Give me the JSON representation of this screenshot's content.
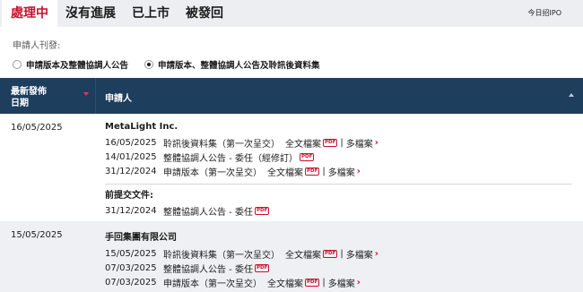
{
  "tabs": [
    {
      "label": "處理中",
      "active": true
    },
    {
      "label": "沒有進展",
      "active": false
    },
    {
      "label": "已上市",
      "active": false
    },
    {
      "label": "被發回",
      "active": false
    }
  ],
  "ipo_link": "今日招IPO",
  "filter": {
    "label": "申請人刊發:",
    "options": [
      {
        "label": "申請版本及整體協調人公告",
        "selected": false
      },
      {
        "label": "申請版本、整體協調人公告及聆訊後資料集",
        "selected": true
      }
    ]
  },
  "table": {
    "col_date": [
      "最新發佈",
      "日期"
    ],
    "col_applicant": "申請人",
    "rows": [
      {
        "date": "16/05/2025",
        "company": "MetaLight Inc.",
        "docs": [
          {
            "date": "16/05/2025",
            "title": "聆訊後資料集（第一次呈交）",
            "full": "全文檔案",
            "pdf": "PDF",
            "more": "多檔案"
          },
          {
            "date": "14/01/2025",
            "title": "整體協調人公告 - 委任（經修訂）",
            "full": "",
            "pdf": "PDF",
            "more": ""
          },
          {
            "date": "31/12/2024",
            "title": "申請版本（第一次呈交）",
            "full": "全文檔案",
            "pdf": "PDF",
            "more": "多檔案"
          }
        ],
        "prior_label": "前提交文件:",
        "prior_docs": [
          {
            "date": "31/12/2024",
            "title": "整體協調人公告 - 委任",
            "pdf": "PDF"
          }
        ]
      },
      {
        "date": "15/05/2025",
        "company": "手回集團有限公司",
        "docs": [
          {
            "date": "15/05/2025",
            "title": "聆訊後資料集（第一次呈交）",
            "full": "全文檔案",
            "pdf": "PDF",
            "more": "多檔案"
          },
          {
            "date": "07/03/2025",
            "title": "整體協調人公告 - 委任",
            "full": "",
            "pdf": "PDF",
            "more": ""
          },
          {
            "date": "07/03/2025",
            "title": "申請版本（第一次呈交）",
            "full": "全文檔案",
            "pdf": "PDF",
            "more": "多檔案"
          }
        ]
      }
    ]
  },
  "colors": {
    "accent": "#c8102e",
    "header_bg": "#1e3e5e",
    "tabbar_bg": "#eceef1",
    "alt_row_bg": "#eef0f3"
  }
}
